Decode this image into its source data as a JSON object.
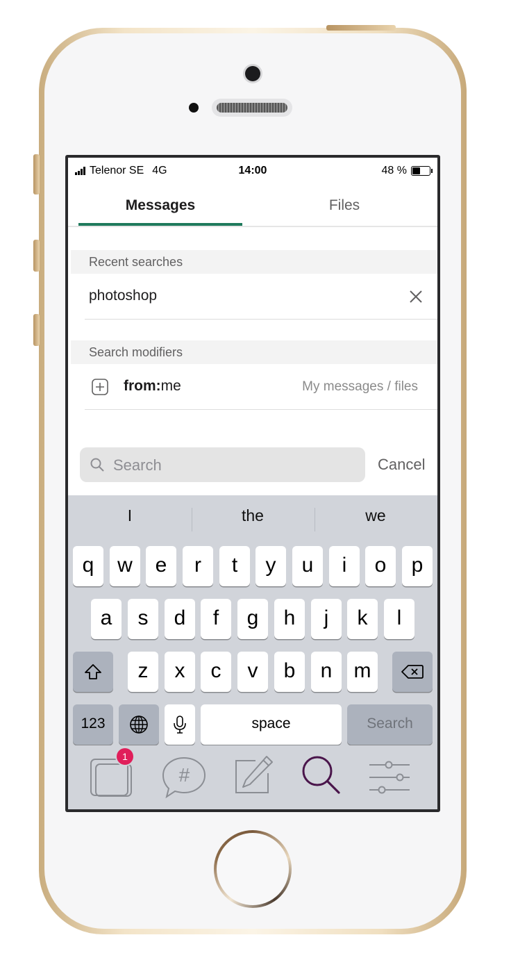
{
  "status_bar": {
    "carrier": "Telenor SE",
    "network": "4G",
    "time": "14:00",
    "battery": "48 %"
  },
  "tabs": [
    {
      "label": "Messages",
      "selected": true
    },
    {
      "label": "Files",
      "selected": false
    }
  ],
  "recent": {
    "header": "Recent searches",
    "items": [
      "photoshop"
    ]
  },
  "modifiers": {
    "header": "Search modifiers",
    "items": [
      {
        "key": "from:",
        "value": "me",
        "description": "My messages / files"
      }
    ]
  },
  "search": {
    "placeholder": "Search",
    "cancel_label": "Cancel"
  },
  "keyboard": {
    "predictions": [
      "I",
      "the",
      "we"
    ],
    "row1": [
      "q",
      "w",
      "e",
      "r",
      "t",
      "y",
      "u",
      "i",
      "o",
      "p"
    ],
    "row2": [
      "a",
      "s",
      "d",
      "f",
      "g",
      "h",
      "j",
      "k",
      "l"
    ],
    "row3": [
      "z",
      "x",
      "c",
      "v",
      "b",
      "n",
      "m"
    ],
    "numbers_label": "123",
    "space_label": "space",
    "return_label": "Search"
  },
  "bottom_nav": {
    "unread_badge": "1",
    "icons": [
      "home-icon",
      "channels-icon",
      "compose-icon",
      "search-icon",
      "settings-icon"
    ]
  },
  "colors": {
    "accent": "#1f7a5c",
    "badge": "#e01e5a",
    "search_active": "#4a154b"
  }
}
